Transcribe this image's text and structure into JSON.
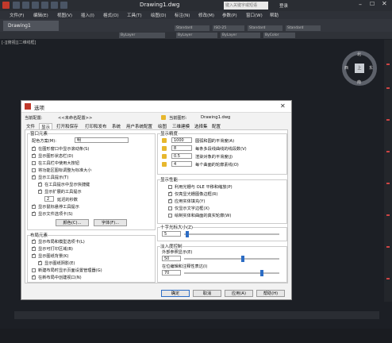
{
  "app": {
    "title": "Drawing1.dwg",
    "search_placeholder": "键入关键字或短语",
    "login": "登录"
  },
  "menu": [
    "文件(F)",
    "编辑(E)",
    "视图(V)",
    "插入(I)",
    "格式(O)",
    "工具(T)",
    "绘图(D)",
    "标注(N)",
    "修改(M)",
    "参数(P)",
    "窗口(W)",
    "帮助"
  ],
  "doc_tab": "Drawing1",
  "property_bar": [
    "ByLayer",
    "ByLayer",
    "ByLayer",
    "ByColor",
    "Standard",
    "ISO-25",
    "Standard",
    "Standard"
  ],
  "view_label": "[-][俯视][二维线框]",
  "compass": {
    "north": "北",
    "east": "东",
    "west": "西",
    "south": "南",
    "cube": "上"
  },
  "dialog": {
    "title": "选项",
    "current_profile_label": "当前配置:",
    "current_profile_value": "<<未命名配置>>",
    "current_drawing_label": "当前图形:",
    "current_drawing_value": "Drawing1.dwg",
    "tabs": [
      "文件",
      "显示",
      "打开和保存",
      "打印和发布",
      "系统",
      "用户系统配置",
      "绘图",
      "三维建模",
      "选择集",
      "配置"
    ],
    "window_elements": {
      "label": "窗口元素",
      "color_scheme_label": "配色方案(M):",
      "color_scheme_value": "明",
      "options": [
        {
          "label": "在图形窗口中显示滚动条(S)",
          "checked": true
        },
        {
          "label": "显示图形状态栏(D)",
          "checked": true
        },
        {
          "label": "在工具栏中使用大按钮",
          "checked": false
        },
        {
          "label": "将功能区图标调整为标准大小",
          "checked": false
        },
        {
          "label": "显示工具提示(T)",
          "checked": true
        },
        {
          "label": "在工具提示中显示快捷键",
          "checked": true
        },
        {
          "label": "显示扩展的工具提示",
          "checked": true
        },
        {
          "label": "显示鼠标悬停工具提示",
          "checked": true
        },
        {
          "label": "显示文件选项卡(S)",
          "checked": true
        }
      ],
      "delay_value": "2",
      "delay_label": "延迟的秒数",
      "colors_button": "颜色(C)...",
      "fonts_button": "字体(F)..."
    },
    "layout_elements": {
      "label": "布局元素",
      "options": [
        {
          "label": "显示布局和模型选项卡(L)",
          "checked": true
        },
        {
          "label": "显示可打印区域(B)",
          "checked": true
        },
        {
          "label": "显示图纸背景(K)",
          "checked": true
        },
        {
          "label": "显示图纸阴影(E)",
          "checked": true
        },
        {
          "label": "新建布局时显示页面设置管理器(G)",
          "checked": false
        },
        {
          "label": "在新布局中创建视口(N)",
          "checked": true
        }
      ]
    },
    "display_resolution": {
      "label": "显示精度",
      "rows": [
        {
          "value": "1000",
          "label": "圆弧和圆的平滑度(A)"
        },
        {
          "value": "8",
          "label": "每条多段线曲线的线段数(V)"
        },
        {
          "value": "0.5",
          "label": "渲染对象的平滑度(J)"
        },
        {
          "value": "4",
          "label": "每个曲面的轮廓素线(O)"
        }
      ]
    },
    "display_performance": {
      "label": "显示性能",
      "options": [
        {
          "label": "利用光栅与 OLE 平移和缩放(P)",
          "checked": false
        },
        {
          "label": "仅亮显光栅图像边框(R)",
          "checked": true
        },
        {
          "label": "应用实体填充(Y)",
          "checked": true
        },
        {
          "label": "仅显示文字边框(X)",
          "checked": false
        },
        {
          "label": "绘制实体和曲面的真实轮廓(W)",
          "checked": false
        }
      ]
    },
    "crosshair": {
      "label": "十字光标大小(Z)",
      "value": "5"
    },
    "fade_control": {
      "label": "淡入度控制",
      "xref_label": "外部参照显示(E)",
      "xref_value": "50",
      "inplace_label": "在位编辑和注释性表达(I)",
      "inplace_value": "70"
    },
    "buttons": {
      "ok": "确定",
      "cancel": "取消",
      "apply": "应用(A)",
      "help": "帮助(H)"
    }
  }
}
